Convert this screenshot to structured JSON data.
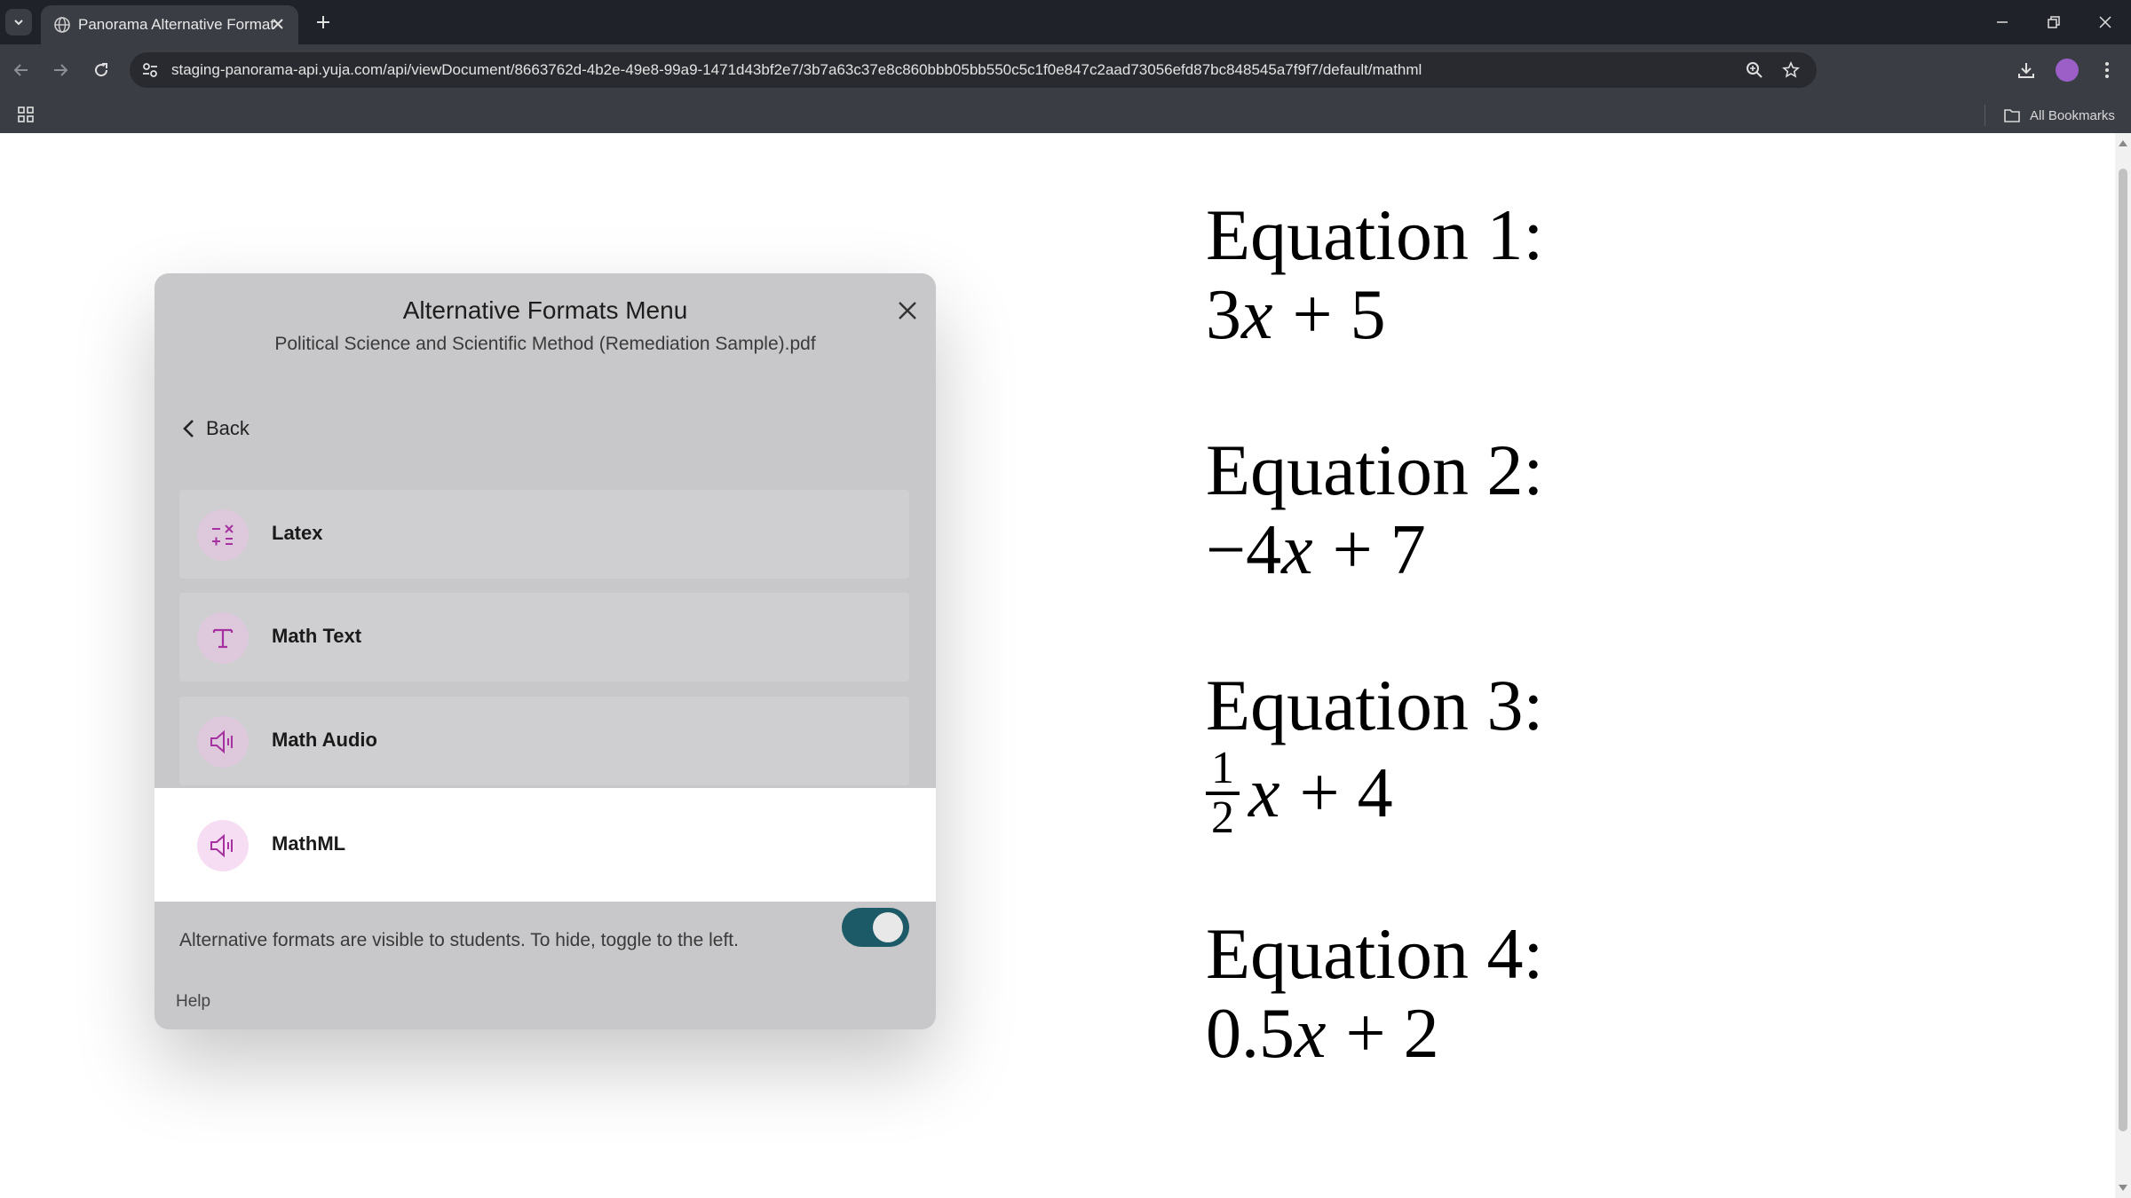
{
  "browser": {
    "tab_title": "Panorama Alternative Format",
    "url": "staging-panorama-api.yuja.com/api/viewDocument/8663762d-4b2e-49e8-99a9-1471d43bf2e7/3b7a63c37e8c860bbb05bb550c5c1f0e847c2aad73056efd87bc848545a7f9f7/default/mathml",
    "all_bookmarks_label": "All Bookmarks"
  },
  "document": {
    "equations": [
      {
        "label": "Equation 1:",
        "coef": "3",
        "rest": "+ 5"
      },
      {
        "label": "Equation 2:",
        "coef": "−4",
        "rest": "+ 7"
      },
      {
        "label": "Equation 3:",
        "frac_num": "1",
        "frac_den": "2",
        "rest": "+ 4"
      },
      {
        "label": "Equation 4:",
        "coef": "0.5",
        "rest": "+ 2"
      }
    ],
    "variable": "x"
  },
  "modal": {
    "title": "Alternative Formats Menu",
    "subtitle": "Political Science and Scientific Method (Remediation Sample).pdf",
    "back_label": "Back",
    "formats": [
      {
        "label": "Latex",
        "icon": "math-operators-icon"
      },
      {
        "label": "Math Text",
        "icon": "text-t-icon"
      },
      {
        "label": "Math Audio",
        "icon": "speaker-icon"
      },
      {
        "label": "MathML",
        "icon": "speaker-icon",
        "selected": true
      }
    ],
    "visibility_note": "Alternative formats are visible to students. To hide, toggle to the left.",
    "toggle_on": true,
    "help_label": "Help"
  },
  "colors": {
    "accent_icon": "#a5309f",
    "toggle": "#1b5a66",
    "profile": "#9b5fc7"
  }
}
